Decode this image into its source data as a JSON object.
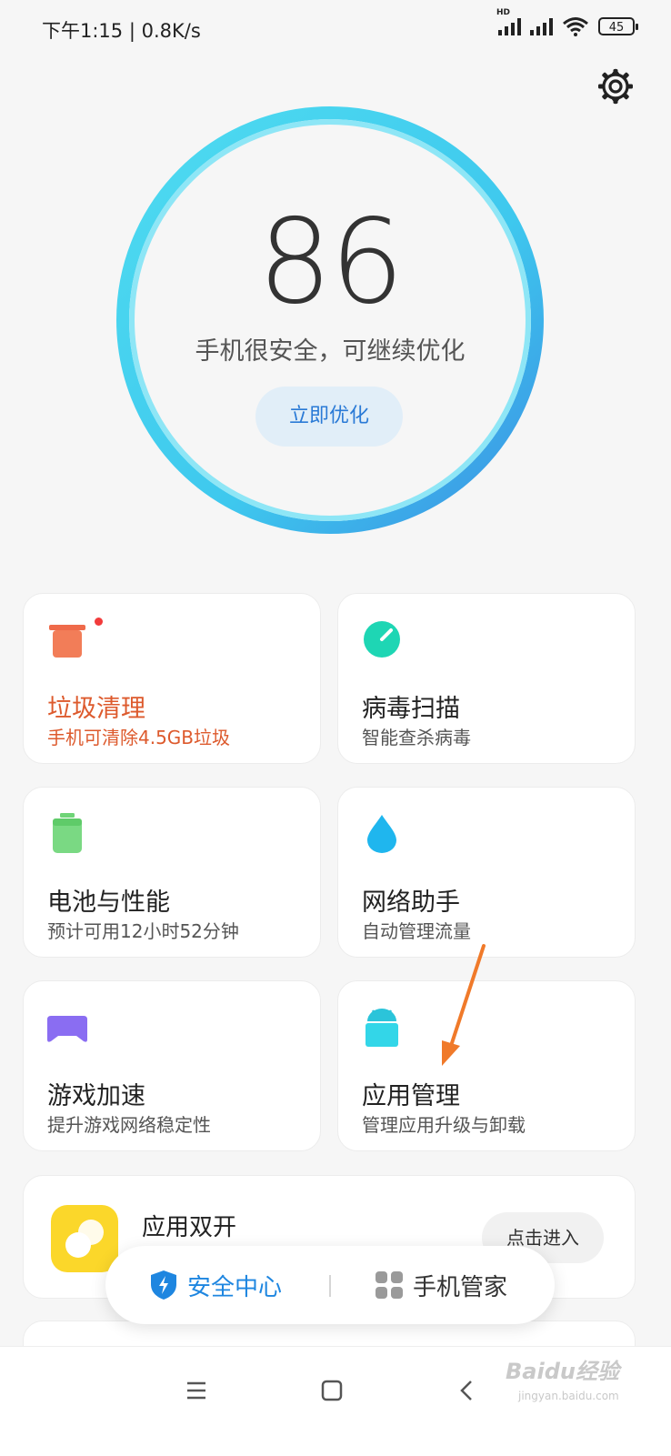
{
  "status_bar": {
    "time": "下午1:15 | 0.8K/s",
    "network_tag": "HD",
    "battery": "45"
  },
  "score_panel": {
    "score": "86",
    "description": "手机很安全，可继续优化",
    "optimize_button": "立即优化"
  },
  "cards": [
    {
      "title": "垃圾清理",
      "subtitle": "手机可清除4.5GB垃圾",
      "icon": "trash-icon",
      "color": "#ef6a4a",
      "alert": true
    },
    {
      "title": "病毒扫描",
      "subtitle": "智能查杀病毒",
      "icon": "virus-scan-icon",
      "color": "#1ed6b4"
    },
    {
      "title": "电池与性能",
      "subtitle": "预计可用12小时52分钟",
      "icon": "battery-icon",
      "color": "#6fd477"
    },
    {
      "title": "网络助手",
      "subtitle": "自动管理流量",
      "icon": "water-drop-icon",
      "color": "#1fb6ee"
    },
    {
      "title": "游戏加速",
      "subtitle": "提升游戏网络稳定性",
      "icon": "gamepad-icon",
      "color": "#8a6df2"
    },
    {
      "title": "应用管理",
      "subtitle": "管理应用升级与卸载",
      "icon": "android-icon",
      "color": "#27d0e4"
    }
  ],
  "dual_apps": {
    "title": "应用双开",
    "enter_button": "点击进入",
    "icon": "dual-app-icon",
    "color": "#fbd72a"
  },
  "tab_switcher": {
    "security_center": "安全中心",
    "phone_manager": "手机管家",
    "active_color": "#1e86e0"
  },
  "annotation": {
    "arrow_color": "#f07a2a"
  },
  "watermark": {
    "brand": "Baidu经验",
    "url": "jingyan.baidu.com"
  }
}
